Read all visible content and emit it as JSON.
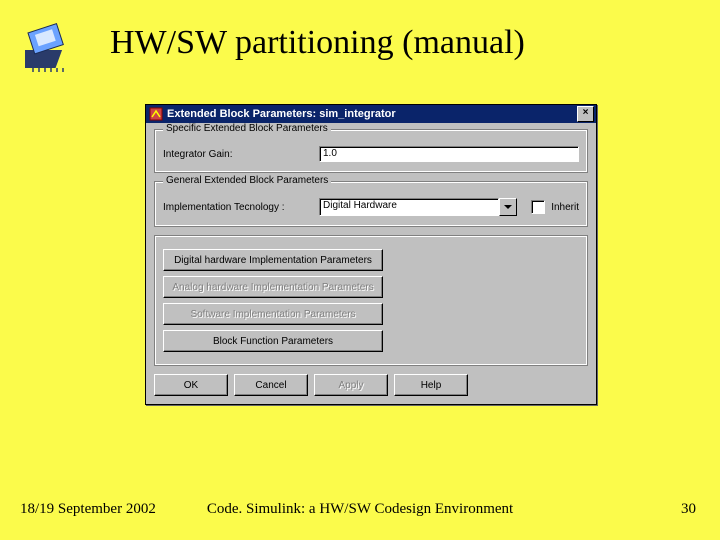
{
  "slide": {
    "title": "HW/SW partitioning (manual)",
    "footer_left": "18/19 September 2002",
    "footer_center": "Code. Simulink: a HW/SW Codesign Environment",
    "footer_right": "30"
  },
  "dialog": {
    "title": "Extended Block Parameters: sim_integrator",
    "close_glyph": "×",
    "group_specific": {
      "legend": "Specific Extended Block Parameters",
      "gain_label": "Integrator Gain:",
      "gain_value": "1.0"
    },
    "group_general": {
      "legend": "General Extended Block Parameters",
      "tech_label": "Implementation Tecnology :",
      "tech_value": "Digital Hardware",
      "inherit_label": "Inherit"
    },
    "param_buttons": {
      "b1": "Digital hardware Implementation Parameters",
      "b2": "Analog hardware Implementation Parameters",
      "b3": "Software Implementation Parameters",
      "b4": "Block Function Parameters"
    },
    "footer_buttons": {
      "ok": "OK",
      "cancel": "Cancel",
      "apply": "Apply",
      "help": "Help"
    }
  }
}
